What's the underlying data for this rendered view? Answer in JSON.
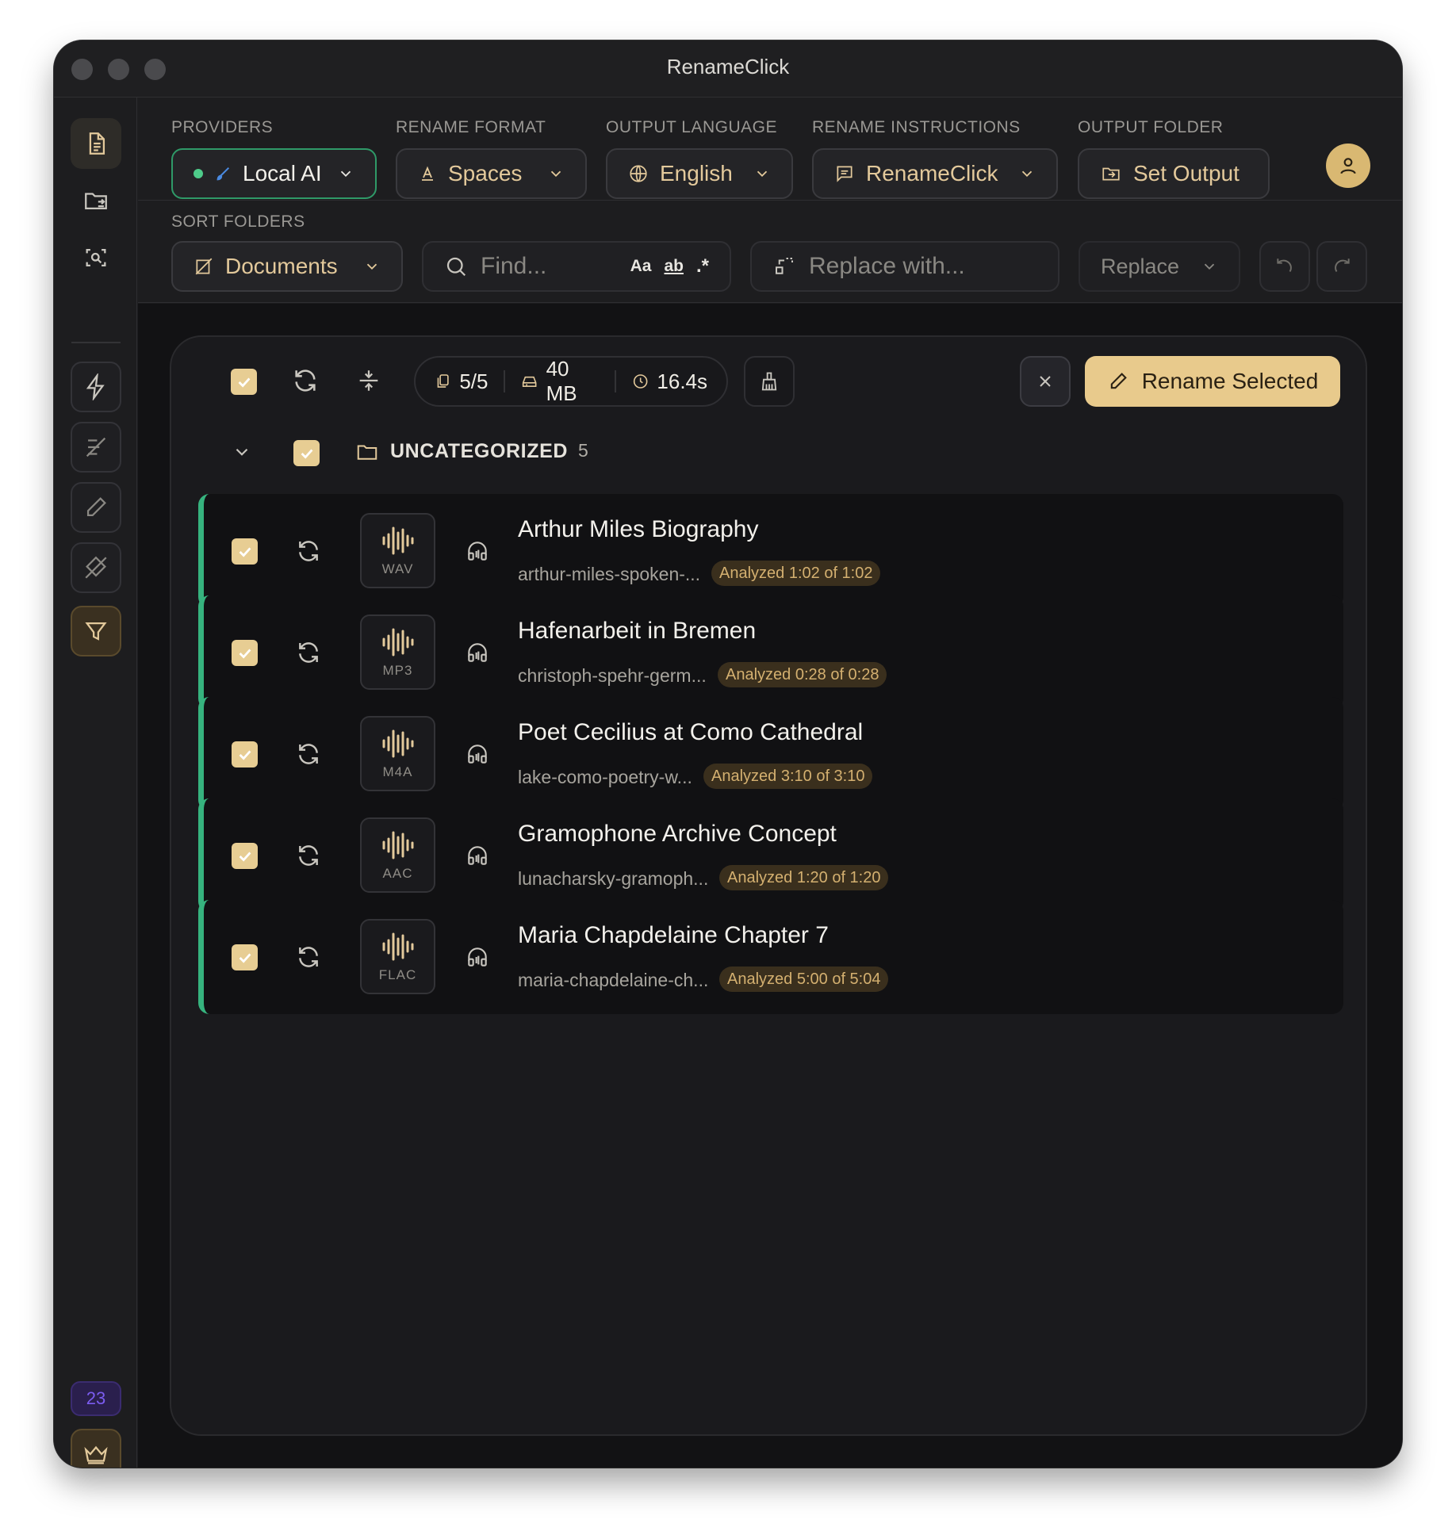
{
  "window": {
    "title": "RenameClick"
  },
  "toolbar": {
    "providers": {
      "label": "PROVIDERS",
      "value": "Local AI"
    },
    "rename_format": {
      "label": "RENAME FORMAT",
      "value": "Spaces"
    },
    "output_language": {
      "label": "OUTPUT LANGUAGE",
      "value": "English"
    },
    "rename_instructions": {
      "label": "RENAME INSTRUCTIONS",
      "value": "RenameClick"
    },
    "output_folder": {
      "label": "OUTPUT FOLDER",
      "value": "Set Output"
    }
  },
  "sort": {
    "label": "SORT FOLDERS",
    "folder": "Documents",
    "find_placeholder": "Find...",
    "find_opts": {
      "case": "Aa",
      "word": "ab",
      "regex": ".*"
    },
    "replace_placeholder": "Replace with...",
    "replace_mode": "Replace"
  },
  "stats": {
    "count": "5/5",
    "size": "40 MB",
    "time": "16.4s"
  },
  "actions": {
    "rename_selected": "Rename Selected"
  },
  "category": {
    "name": "UNCATEGORIZED",
    "count": "5"
  },
  "files": [
    {
      "title": "Arthur Miles Biography",
      "filename": "arthur-miles-spoken-...",
      "ext": "WAV",
      "status": "Analyzed 1:02 of 1:02"
    },
    {
      "title": "Hafenarbeit in Bremen",
      "filename": "christoph-spehr-germ...",
      "ext": "MP3",
      "status": "Analyzed 0:28 of 0:28"
    },
    {
      "title": "Poet Cecilius at Como Cathedral",
      "filename": "lake-como-poetry-w...",
      "ext": "M4A",
      "status": "Analyzed 3:10 of 3:10"
    },
    {
      "title": "Gramophone Archive Concept",
      "filename": "lunacharsky-gramoph...",
      "ext": "AAC",
      "status": "Analyzed 1:20 of 1:20"
    },
    {
      "title": "Maria Chapdelaine Chapter 7",
      "filename": "maria-chapdelaine-ch...",
      "ext": "FLAC",
      "status": "Analyzed 5:00 of 5:04"
    }
  ],
  "sidebar": {
    "badge_count": "23"
  },
  "colors": {
    "accent": "#e8ca8c",
    "status_green": "#36b37e",
    "badge_purple": "#7b5cf0"
  }
}
